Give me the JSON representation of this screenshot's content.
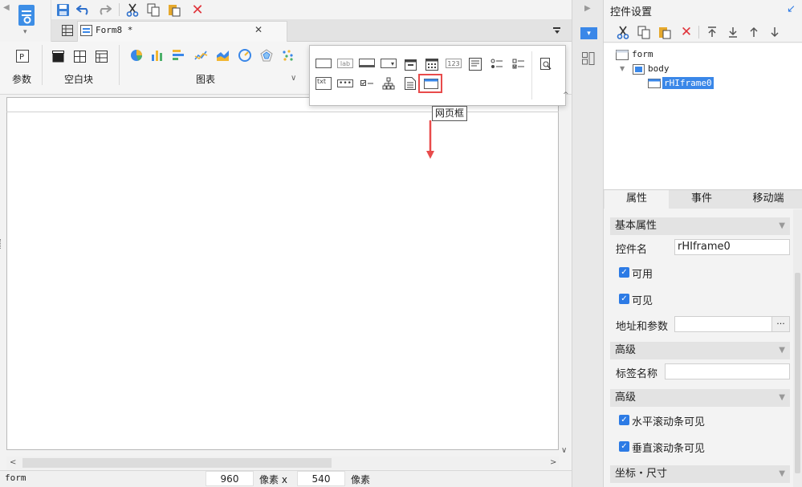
{
  "toolbar": {
    "app_menu_icon": "report-designer-icon",
    "dropdown_arrow": "▾"
  },
  "tab": {
    "title": "Form8 *",
    "close": "✕"
  },
  "ribbon": {
    "groups": [
      {
        "label": "参数"
      },
      {
        "label": "空白块"
      },
      {
        "label": "图表"
      }
    ]
  },
  "popup": {
    "tooltip": "网页框"
  },
  "status": {
    "left": "form",
    "width": "960",
    "width_unit": "像素 x",
    "height": "540",
    "height_unit": "像素"
  },
  "right_panel": {
    "title": "控件设置",
    "tree": {
      "root": "form",
      "body": "body",
      "selected": "rHIframe0"
    },
    "tabs": [
      "属性",
      "事件",
      "移动端"
    ],
    "sections": {
      "basic": "基本属性",
      "advanced1": "高级",
      "advanced2": "高级",
      "coords": "坐标・尺寸"
    },
    "props": {
      "name_label": "控件名",
      "name_value": "rHIframe0",
      "enabled_label": "可用",
      "visible_label": "可见",
      "url_label": "地址和参数",
      "url_value": "",
      "url_button": "···",
      "tagname_label": "标签名称",
      "tagname_value": "",
      "hscroll_label": "水平滚动条可见",
      "vscroll_label": "垂直滚动条可见"
    }
  },
  "colors": {
    "accent": "#2d7be5",
    "highlight": "#e84b4b",
    "selected_bg": "#3a87e8"
  }
}
